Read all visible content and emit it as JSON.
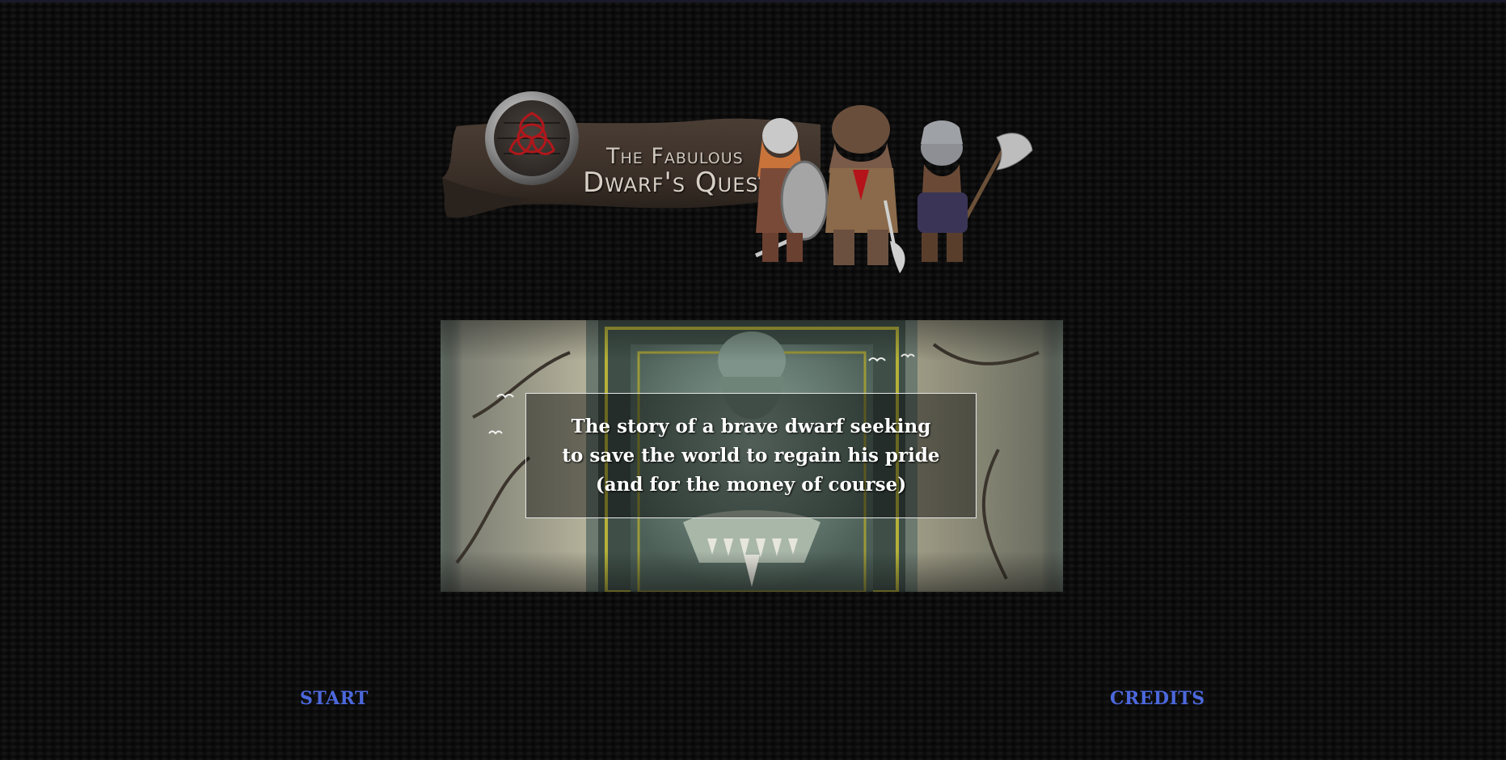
{
  "logo": {
    "title_small": "The Fabulous",
    "title_big": "Dwarf's Quest"
  },
  "story": {
    "lines": [
      "The story of a brave dwarf seeking",
      "to save the world to regain his pride",
      "(and for the money of course)"
    ]
  },
  "menu": {
    "start_label": "START",
    "credits_label": "CREDITS"
  },
  "colors": {
    "background": "#0c0c0c",
    "link": "#4c68dc",
    "story_text": "#ffffff",
    "title_text": "#d8d0c6"
  }
}
